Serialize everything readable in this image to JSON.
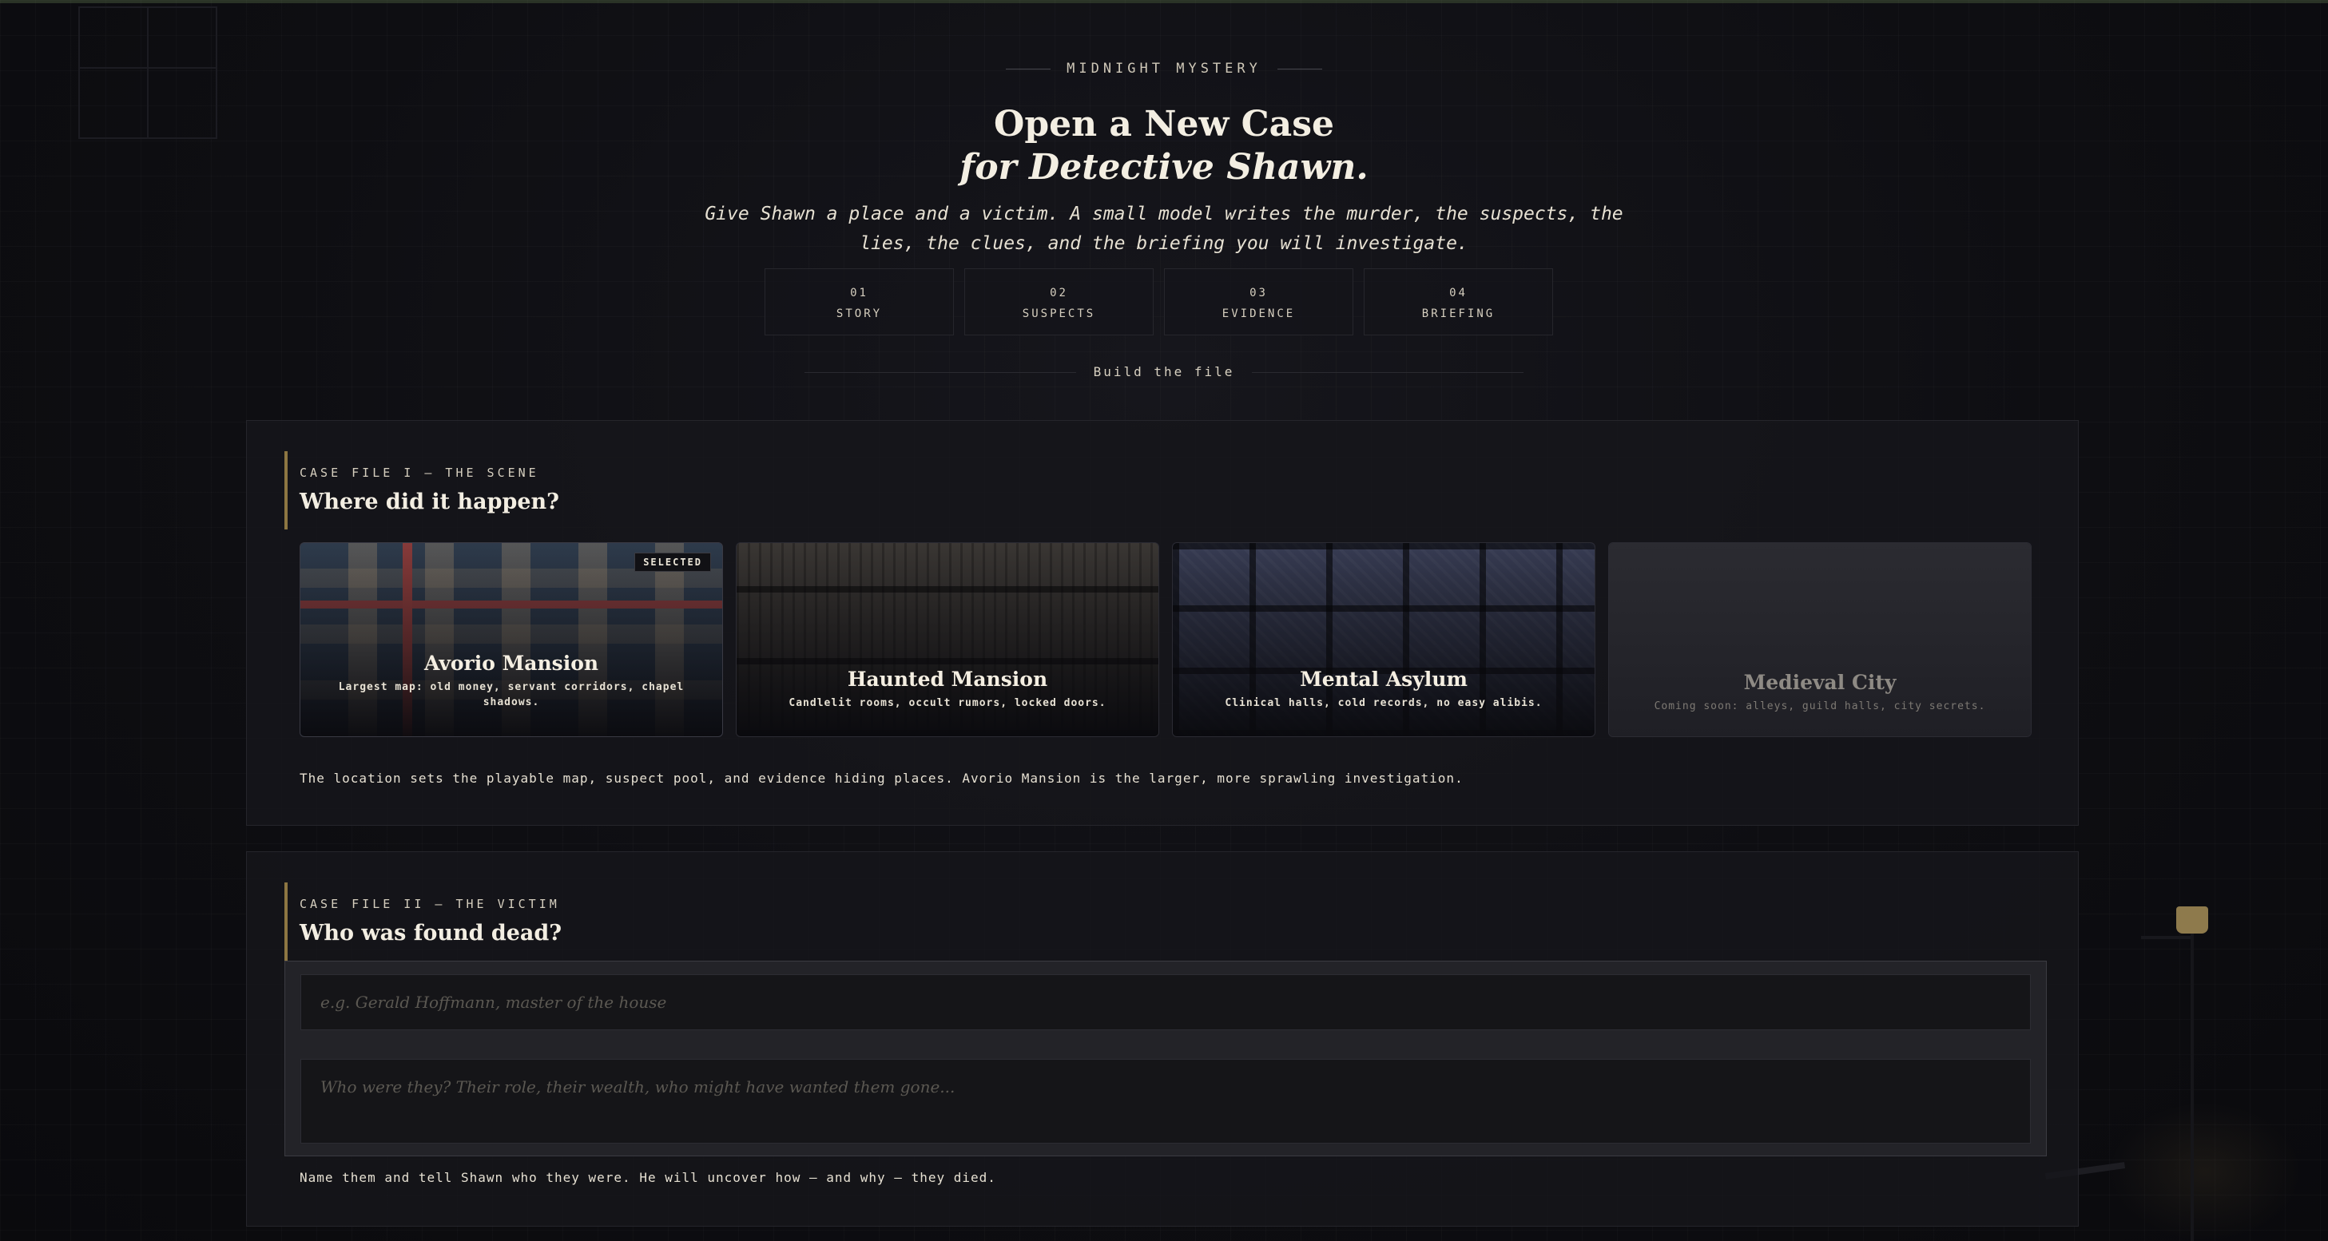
{
  "header": {
    "kicker": "MIDNIGHT MYSTERY",
    "title_line1": "Open a New Case",
    "title_line2": "for Detective Shawn.",
    "subtitle": "Give Shawn a place and a victim. A small model writes the murder, the suspects, the lies, the clues, and the briefing you will investigate."
  },
  "steps": [
    {
      "num": "01",
      "label": "STORY"
    },
    {
      "num": "02",
      "label": "SUSPECTS"
    },
    {
      "num": "03",
      "label": "EVIDENCE"
    },
    {
      "num": "04",
      "label": "BRIEFING"
    }
  ],
  "divider_label": "Build the file",
  "scene": {
    "kicker": "CASE FILE I — THE SCENE",
    "title": "Where did it happen?",
    "cards": [
      {
        "name": "Avorio Mansion",
        "desc": "Largest map: old money, servant corridors, chapel shadows.",
        "badge": "SELECTED",
        "state": "selected"
      },
      {
        "name": "Haunted Mansion",
        "desc": "Candlelit rooms, occult rumors, locked doors.",
        "state": "available"
      },
      {
        "name": "Mental Asylum",
        "desc": "Clinical halls, cold records, no easy alibis.",
        "state": "available"
      },
      {
        "name": "Medieval City",
        "desc": "Coming soon: alleys, guild halls, city secrets.",
        "state": "disabled"
      }
    ],
    "note": "The location sets the playable map, suspect pool, and evidence hiding places. Avorio Mansion is the larger, more sprawling investigation."
  },
  "victim": {
    "kicker": "CASE FILE II — THE VICTIM",
    "title": "Who was found dead?",
    "name_placeholder": "e.g. Gerald Hoffmann, master of the house",
    "name_value": "",
    "bio_placeholder": "Who were they? Their role, their wealth, who might have wanted them gone...",
    "bio_value": "",
    "note": "Name them and tell Shawn who they were. He will uncover how — and why — they died."
  },
  "colors": {
    "accent": "#8d7642",
    "background": "#0e0e12",
    "text": "#ece6d8"
  }
}
